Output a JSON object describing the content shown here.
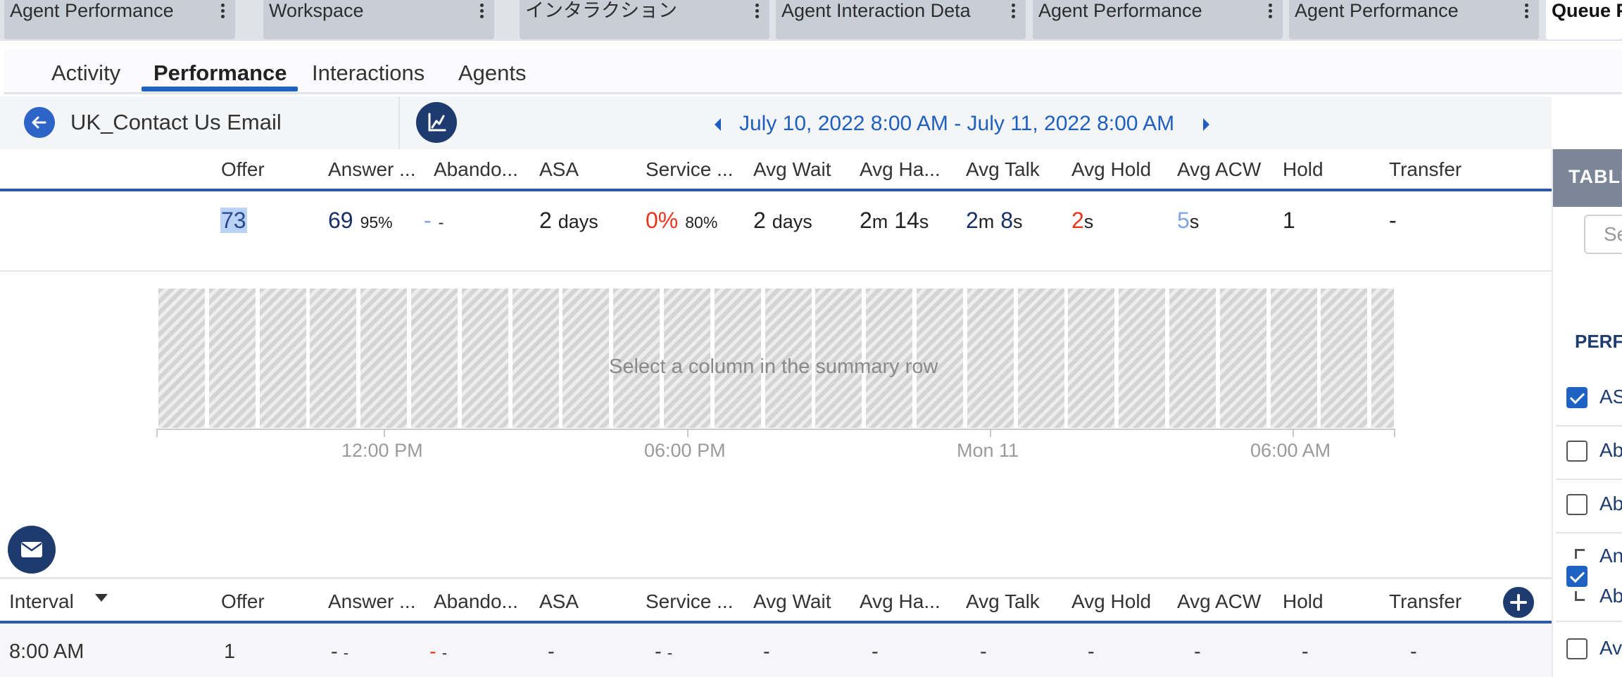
{
  "top_tabs": [
    {
      "label": "Agent Performance"
    },
    {
      "label": "Workspace"
    },
    {
      "label": "インタラクション"
    },
    {
      "label": "Agent Interaction Deta"
    },
    {
      "label": "Agent Performance"
    },
    {
      "label": "Agent Performance"
    },
    {
      "label": "Queue P"
    }
  ],
  "sub_nav": [
    "Activity",
    "Performance",
    "Interactions",
    "Agents"
  ],
  "header": {
    "queue_name": "UK_Contact Us Email",
    "date_range": "July 10, 2022 8:00 AM - July 11, 2022 8:00 AM"
  },
  "columns": [
    "Offer",
    "Answer ...",
    "Abando...",
    "ASA",
    "Service ...",
    "Avg Wait",
    "Avg Ha...",
    "Avg Talk",
    "Avg Hold",
    "Avg ACW",
    "Hold",
    "Transfer"
  ],
  "summary": {
    "offer": "73",
    "answer": "69",
    "answer_pct": "95%",
    "abandon": "-",
    "abandon_sub": "-",
    "asa_num": "2",
    "asa_unit": "days",
    "service_pct": "0%",
    "service_target": "80%",
    "avg_wait_num": "2",
    "avg_wait_unit": "days",
    "avg_handle_m": "2",
    "avg_handle_m_unit": "m",
    "avg_handle_s": "14",
    "avg_handle_s_unit": "s",
    "avg_talk_m": "2",
    "avg_talk_m_unit": "m",
    "avg_talk_s": "8",
    "avg_talk_s_unit": "s",
    "avg_hold_num": "2",
    "avg_hold_unit": "s",
    "avg_acw_num": "5",
    "avg_acw_unit": "s",
    "hold": "1",
    "transfer": "-"
  },
  "chart": {
    "message": "Select a column in the summary row",
    "ticks": [
      "12:00 PM",
      "06:00 PM",
      "Mon 11",
      "06:00 AM"
    ]
  },
  "interval_table": {
    "first_col": "Interval",
    "row": {
      "interval": "8:00 AM",
      "offer": "1",
      "answer": "-",
      "answer_sub": "-",
      "abandon": "-",
      "abandon_sub": "-",
      "asa": "-",
      "service": "-",
      "service_sub": "-",
      "avg_wait": "-",
      "avg_handle": "-",
      "avg_talk": "-",
      "avg_hold": "-",
      "avg_acw": "-",
      "hold": "-",
      "transfer": "-"
    }
  },
  "right_panel": {
    "header": "TABLE",
    "search_placeholder": "Se",
    "section": "PERFO",
    "items": [
      {
        "label": "AS",
        "checked": true
      },
      {
        "label": "Ab",
        "checked": false
      },
      {
        "label": "Ab",
        "checked": false
      },
      {
        "label": "An",
        "checked": true
      },
      {
        "label": "Ab",
        "checked": true
      },
      {
        "label": "Av",
        "checked": false
      }
    ]
  }
}
